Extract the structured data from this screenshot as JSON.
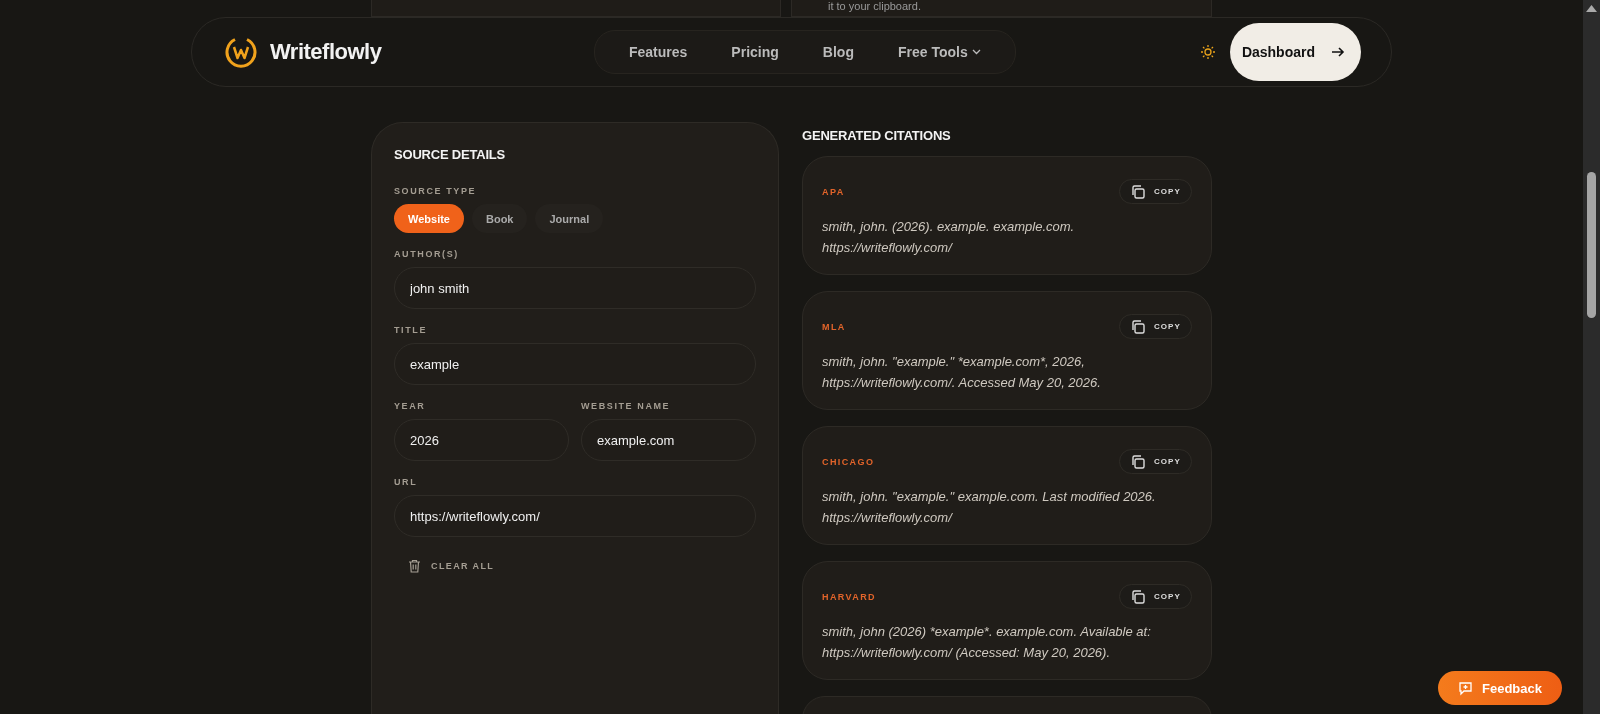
{
  "peek": {
    "text": "it to your clipboard."
  },
  "nav": {
    "brand": "Writeflowly",
    "links": [
      {
        "label": "Features",
        "dropdown": false
      },
      {
        "label": "Pricing",
        "dropdown": false
      },
      {
        "label": "Blog",
        "dropdown": false
      },
      {
        "label": "Free Tools",
        "dropdown": true
      }
    ],
    "cta": "Dashboard"
  },
  "source": {
    "title": "SOURCE DETAILS",
    "type_label": "SOURCE TYPE",
    "types": [
      {
        "label": "Website",
        "selected": true
      },
      {
        "label": "Book",
        "selected": false
      },
      {
        "label": "Journal",
        "selected": false
      }
    ],
    "rows": [
      {
        "fields": [
          {
            "label": "AUTHOR(S)",
            "value": "john smith"
          }
        ]
      },
      {
        "fields": [
          {
            "label": "TITLE",
            "value": "example"
          }
        ]
      },
      {
        "fields": [
          {
            "label": "YEAR",
            "value": "2026"
          },
          {
            "label": "WEBSITE NAME",
            "value": "example.com"
          }
        ]
      },
      {
        "fields": [
          {
            "label": "URL",
            "value": "https://writeflowly.com/"
          }
        ]
      }
    ],
    "clear": "CLEAR ALL"
  },
  "citations": {
    "title": "GENERATED CITATIONS",
    "items": [
      {
        "style": "APA",
        "copy": "COPY",
        "text": "smith, john. (2026). example. example.com. https://writeflowly.com/"
      },
      {
        "style": "MLA",
        "copy": "COPY",
        "text": "smith, john. \"example.\" *example.com*, 2026, https://writeflowly.com/. Accessed May 20, 2026."
      },
      {
        "style": "CHICAGO",
        "copy": "COPY",
        "text": "smith, john. \"example.\" example.com. Last modified 2026. https://writeflowly.com/"
      },
      {
        "style": "HARVARD",
        "copy": "COPY",
        "text": "smith, john (2026) *example*. example.com. Available at: https://writeflowly.com/ (Accessed: May 20, 2026)."
      }
    ]
  },
  "feedback": "Feedback"
}
